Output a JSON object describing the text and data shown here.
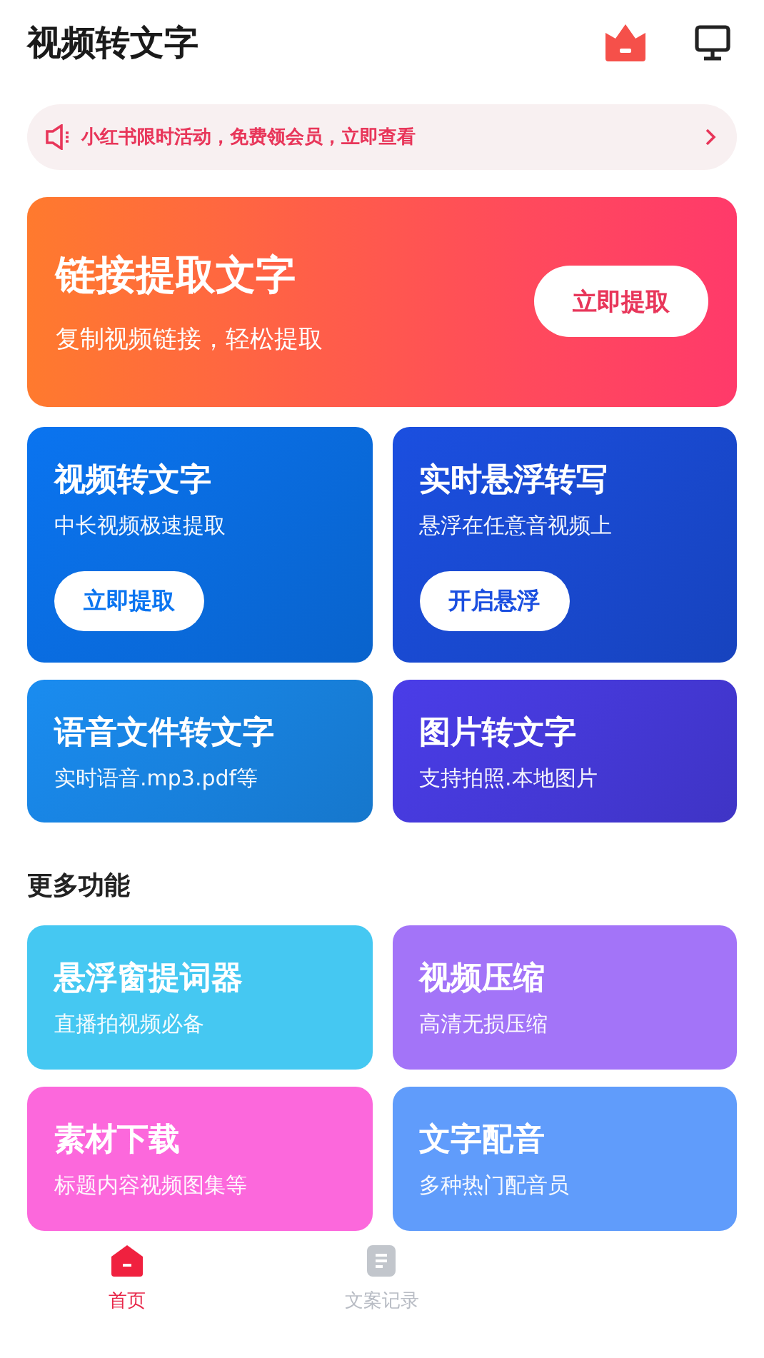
{
  "header": {
    "title": "视频转文字"
  },
  "notice": {
    "text": "小红书限时活动，免费领会员，立即查看"
  },
  "hero": {
    "title": "链接提取文字",
    "subtitle": "复制视频链接，轻松提取",
    "button": "立即提取"
  },
  "main_tools": [
    {
      "title": "视频转文字",
      "subtitle": "中长视频极速提取",
      "button": "立即提取",
      "color": "#0a74f0"
    },
    {
      "title": "实时悬浮转写",
      "subtitle": "悬浮在任意音视频上",
      "button": "开启悬浮",
      "color": "#1b4fe0"
    },
    {
      "title": "语音文件转文字",
      "subtitle": "实时语音.mp3.pdf等",
      "color": "#1a8cf0"
    },
    {
      "title": "图片转文字",
      "subtitle": "支持拍照.本地图片",
      "color": "#4a3de8"
    }
  ],
  "more_section": {
    "title": "更多功能"
  },
  "more_tools": [
    {
      "title": "悬浮窗提词器",
      "subtitle": "直播拍视频必备",
      "color": "#45c8f2"
    },
    {
      "title": "视频压缩",
      "subtitle": "高清无损压缩",
      "color": "#a374f8"
    },
    {
      "title": "素材下载",
      "subtitle": "标题内容视频图集等",
      "color": "#fc68dc"
    },
    {
      "title": "文字配音",
      "subtitle": "多种热门配音员",
      "color": "#609cfb"
    }
  ],
  "tab_bar": [
    {
      "label": "首页",
      "selected": true
    },
    {
      "label": "文案记录",
      "selected": false
    }
  ]
}
